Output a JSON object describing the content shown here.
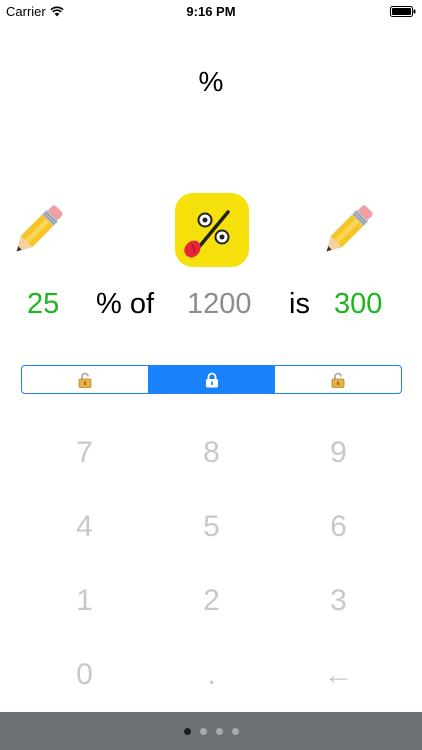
{
  "status_bar": {
    "carrier": "Carrier",
    "time": "9:16 PM",
    "icons": [
      "wifi-icon",
      "battery-icon"
    ]
  },
  "title": "%",
  "header_icons": {
    "left": "pencil-icon",
    "center": "percent-face-app-icon",
    "right": "pencil-icon"
  },
  "equation": {
    "percent_value": "25",
    "percent_of_label": "% of",
    "base_value": "1200",
    "is_label": "is",
    "result_value": "300"
  },
  "lock_selector": {
    "segments": [
      {
        "icon": "open-lock-icon",
        "selected": false
      },
      {
        "icon": "closed-lock-icon",
        "selected": true
      },
      {
        "icon": "open-lock-icon",
        "selected": false
      }
    ]
  },
  "keypad": {
    "rows": [
      [
        "7",
        "8",
        "9"
      ],
      [
        "4",
        "5",
        "6"
      ],
      [
        "1",
        "2",
        "3"
      ],
      [
        "0",
        ".",
        "←"
      ]
    ]
  },
  "pager": {
    "page_count": 4,
    "current_page": 1
  },
  "colors": {
    "accent": "#1a82fb",
    "green_value": "#1fb51f",
    "gray_value": "#8d8d8d",
    "key_text": "#c8c8c8",
    "icon_yellow": "#f6e00c",
    "pager_bar": "#6d7075"
  }
}
